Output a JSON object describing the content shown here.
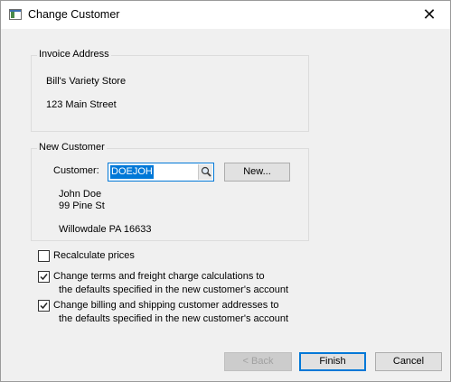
{
  "window": {
    "title": "Change Customer",
    "close_glyph": "✕"
  },
  "invoice_address": {
    "legend": "Invoice Address",
    "name": "Bill's Variety Store",
    "street": "123 Main Street"
  },
  "new_customer": {
    "legend": "New Customer",
    "customer_label": "Customer:",
    "customer_value": "DOEJOH",
    "new_button": "New...",
    "name": "John Doe",
    "street": "99 Pine St",
    "city_line": "Willowdale PA  16633"
  },
  "options": [
    {
      "checked": false,
      "line1": "Recalculate prices",
      "line2": ""
    },
    {
      "checked": true,
      "line1": "Change terms and freight charge calculations to",
      "line2": "the defaults specified in the new customer's account"
    },
    {
      "checked": true,
      "line1": "Change billing and shipping customer addresses to",
      "line2": "the defaults specified in the new customer's account"
    }
  ],
  "footer": {
    "back_label": "< Back",
    "finish_label": "Finish",
    "cancel_label": "Cancel"
  },
  "icons": {
    "app": "window-icon",
    "lookup": "magnifier-icon",
    "check": "checkmark-icon"
  },
  "colors": {
    "accent": "#0078d7",
    "dialog_bg": "#f0f0f0",
    "disabled_text": "#a0a0a0"
  }
}
